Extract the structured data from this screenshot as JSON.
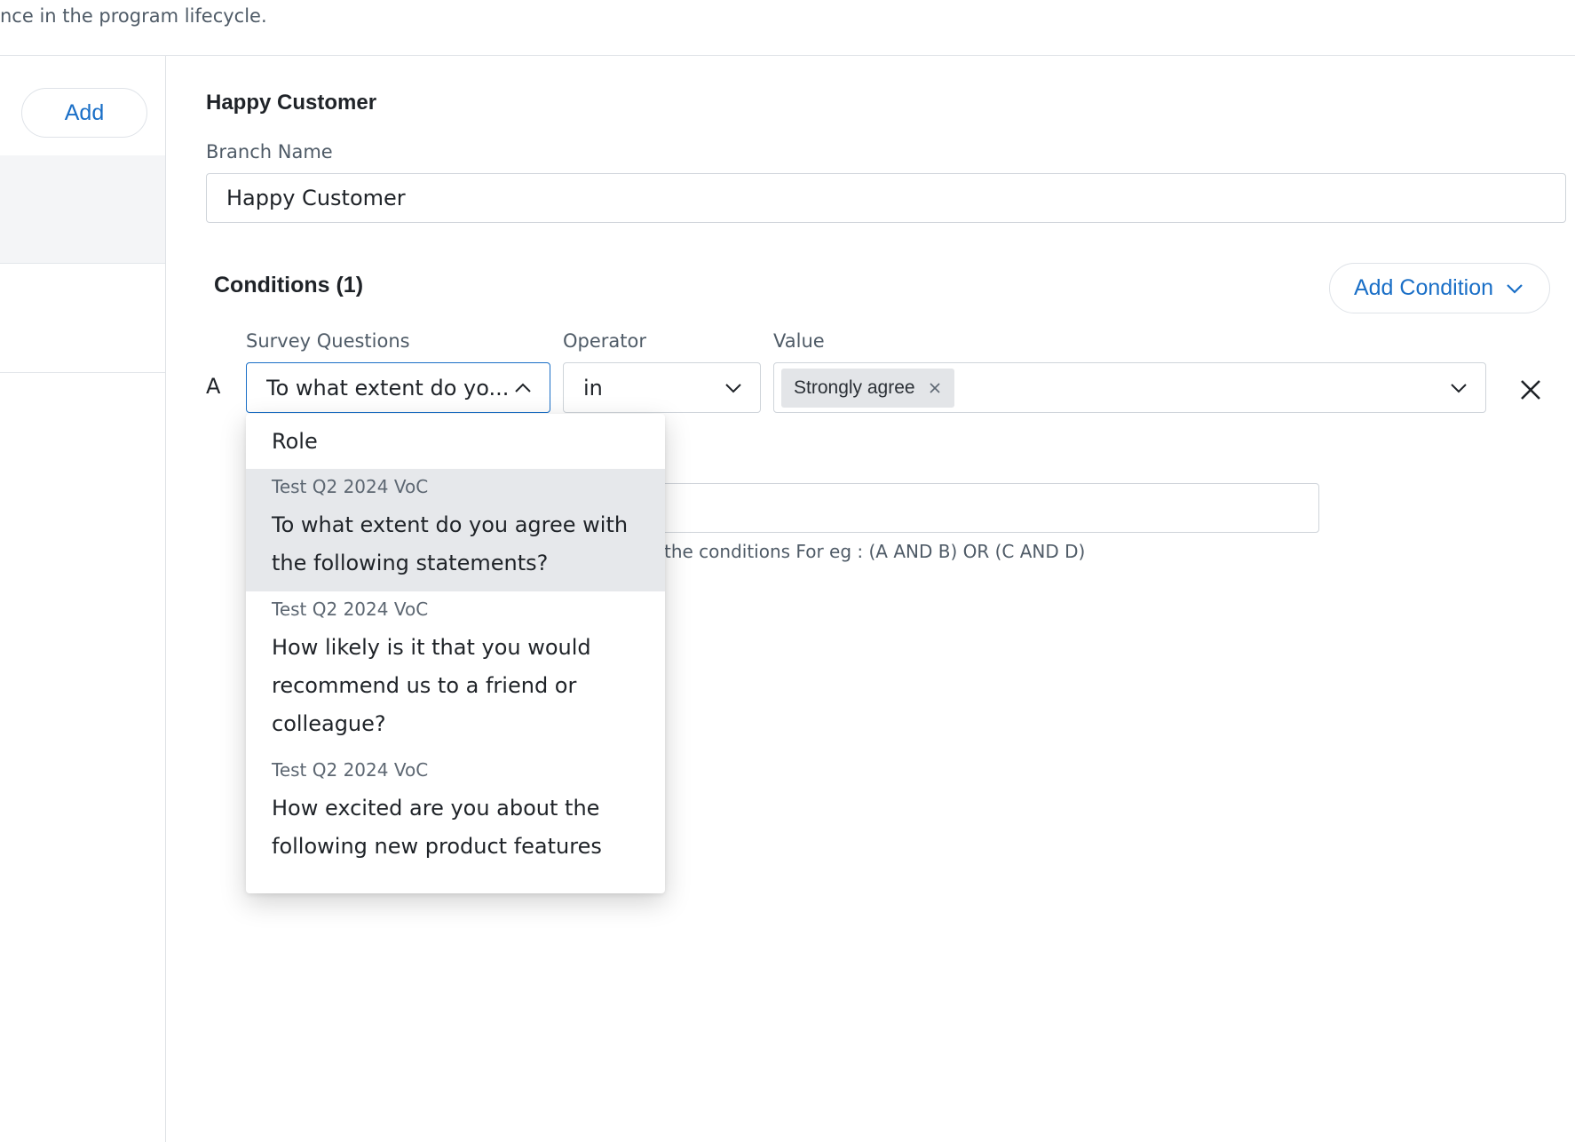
{
  "header": {
    "description": "nce in the program lifecycle."
  },
  "sidebar": {
    "add_label": "Add"
  },
  "branch": {
    "title": "Happy Customer",
    "name_label": "Branch Name",
    "name_value": "Happy Customer"
  },
  "conditions": {
    "title": "Conditions (1)",
    "add_condition_label": "Add Condition",
    "columns": {
      "question": "Survey Questions",
      "operator": "Operator",
      "value": "Value"
    },
    "rows": [
      {
        "letter": "A",
        "question": "To what extent do yo...",
        "operator": "in",
        "value_chip": "Strongly agree"
      }
    ],
    "hint": "the conditions For eg : (A AND B) OR (C AND D)"
  },
  "dropdown": {
    "options": [
      {
        "label": "Role"
      },
      {
        "source": "Test Q2 2024 VoC",
        "label": "To what extent do you agree with the following statements?"
      },
      {
        "source": "Test Q2 2024 VoC",
        "label": "How likely is it that you would recommend us to a friend or colleague?"
      },
      {
        "source": "Test Q2 2024 VoC",
        "label": "How excited are you about the following new product features"
      }
    ]
  },
  "icons": {
    "chevron": "chevron-down-icon",
    "chevron_open": "chevron-up-icon",
    "close": "close-icon",
    "chip_remove": "chip-remove-icon"
  },
  "colors": {
    "accent": "#1a6fc7",
    "selected_bg": "#e6e8eb",
    "chip_bg": "#e3e5e8"
  }
}
